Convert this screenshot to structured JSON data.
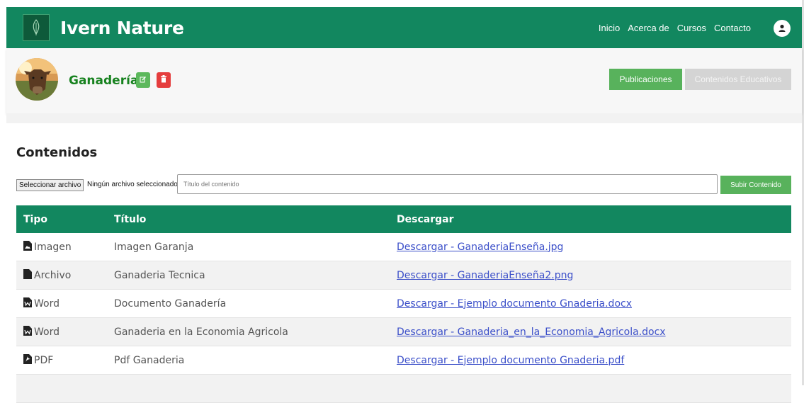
{
  "navbar": {
    "brand": "Ivern Nature",
    "links": [
      "Inicio",
      "Acerca de",
      "Cursos",
      "Contacto"
    ]
  },
  "profile": {
    "name": "Ganadería",
    "tabs": {
      "publications": "Publicaciones",
      "educational": "Contenidos Educativos"
    }
  },
  "contents": {
    "title": "Contenidos",
    "file_button": "Seleccionar archivo",
    "file_status": "Ningún archivo seleccionado",
    "title_placeholder": "Título del contenido",
    "upload_button": "Subir Contenido"
  },
  "table": {
    "headers": [
      "Tipo",
      "Título",
      "Descargar"
    ],
    "rows": [
      {
        "type": "Imagen",
        "icon": "image-file-icon",
        "title": "Imagen Garanja",
        "link": "Descargar - GanaderiaEnseña.jpg"
      },
      {
        "type": "Archivo",
        "icon": "file-icon",
        "title": "Ganaderia Tecnica",
        "link": "Descargar - GanaderiaEnseña2.png"
      },
      {
        "type": "Word",
        "icon": "word-file-icon",
        "title": "Documento Ganadería",
        "link": "Descargar - Ejemplo documento Gnaderia.docx"
      },
      {
        "type": "Word",
        "icon": "word-file-icon",
        "title": "Ganaderia en la Economia Agricola",
        "link": "Descargar - Ganaderia_en_la_Economia_Agricola.docx"
      },
      {
        "type": "PDF",
        "icon": "pdf-file-icon",
        "title": "Pdf Ganaderia",
        "link": "Descargar - Ejemplo documento Gnaderia.pdf"
      }
    ]
  },
  "colors": {
    "primary": "#12875f",
    "accent_green": "#58b25c",
    "danger": "#e53d3d",
    "name_green": "#17821f",
    "link": "#3b4fc9"
  }
}
